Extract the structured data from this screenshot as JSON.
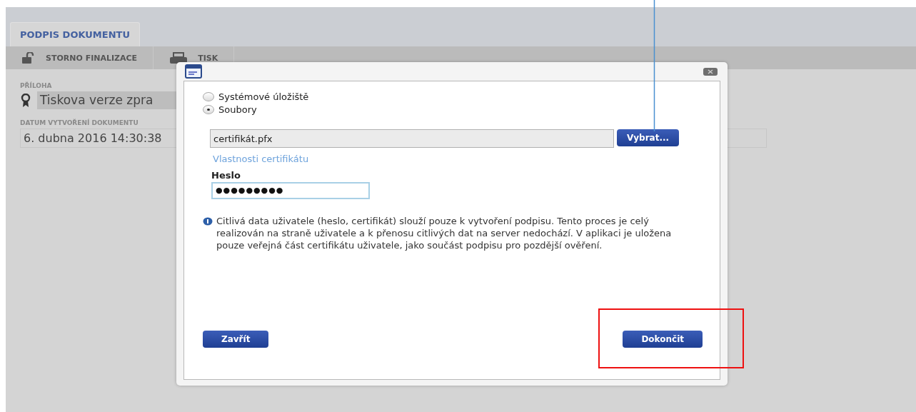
{
  "tabs": [
    {
      "label": "PODPIS DOKUMENTU",
      "selected": true
    }
  ],
  "toolbar": [
    {
      "kind": "lock",
      "label": "STORNO FINALIZACE"
    },
    {
      "kind": "printer",
      "label": "TISK"
    }
  ],
  "fields": [
    {
      "kind": "attachment",
      "label": "PŘÍLOHA",
      "value": "Tiskova verze zpra"
    },
    {
      "kind": "text",
      "label": "DATUM VYTVOŘENÍ DOKUMENTU",
      "value": "6. dubna 2016 14:30:38"
    }
  ],
  "dialog": {
    "sources": [
      {
        "label": "Systémové úložiště",
        "selected": false
      },
      {
        "label": "Soubory",
        "selected": true
      }
    ],
    "file": {
      "value": "certifikát.pfx",
      "button": "Vybrat..."
    },
    "link": "Vlastnosti certifikátu",
    "password": {
      "label": "Heslo",
      "value": "●●●●●●●●●"
    },
    "info": "Citlivá data uživatele (heslo, certifikát) slouží pouze k vytvoření podpisu. Tento proces je celý realizován na straně uživatele a k přenosu citlivých dat na server nedochází. V aplikaci je uložena pouze veřejná část certifikátu uživatele, jako součást podpisu pro pozdější ověření.",
    "buttons": [
      {
        "label": "Zavřít"
      },
      {
        "label": "Dokončit"
      }
    ]
  }
}
